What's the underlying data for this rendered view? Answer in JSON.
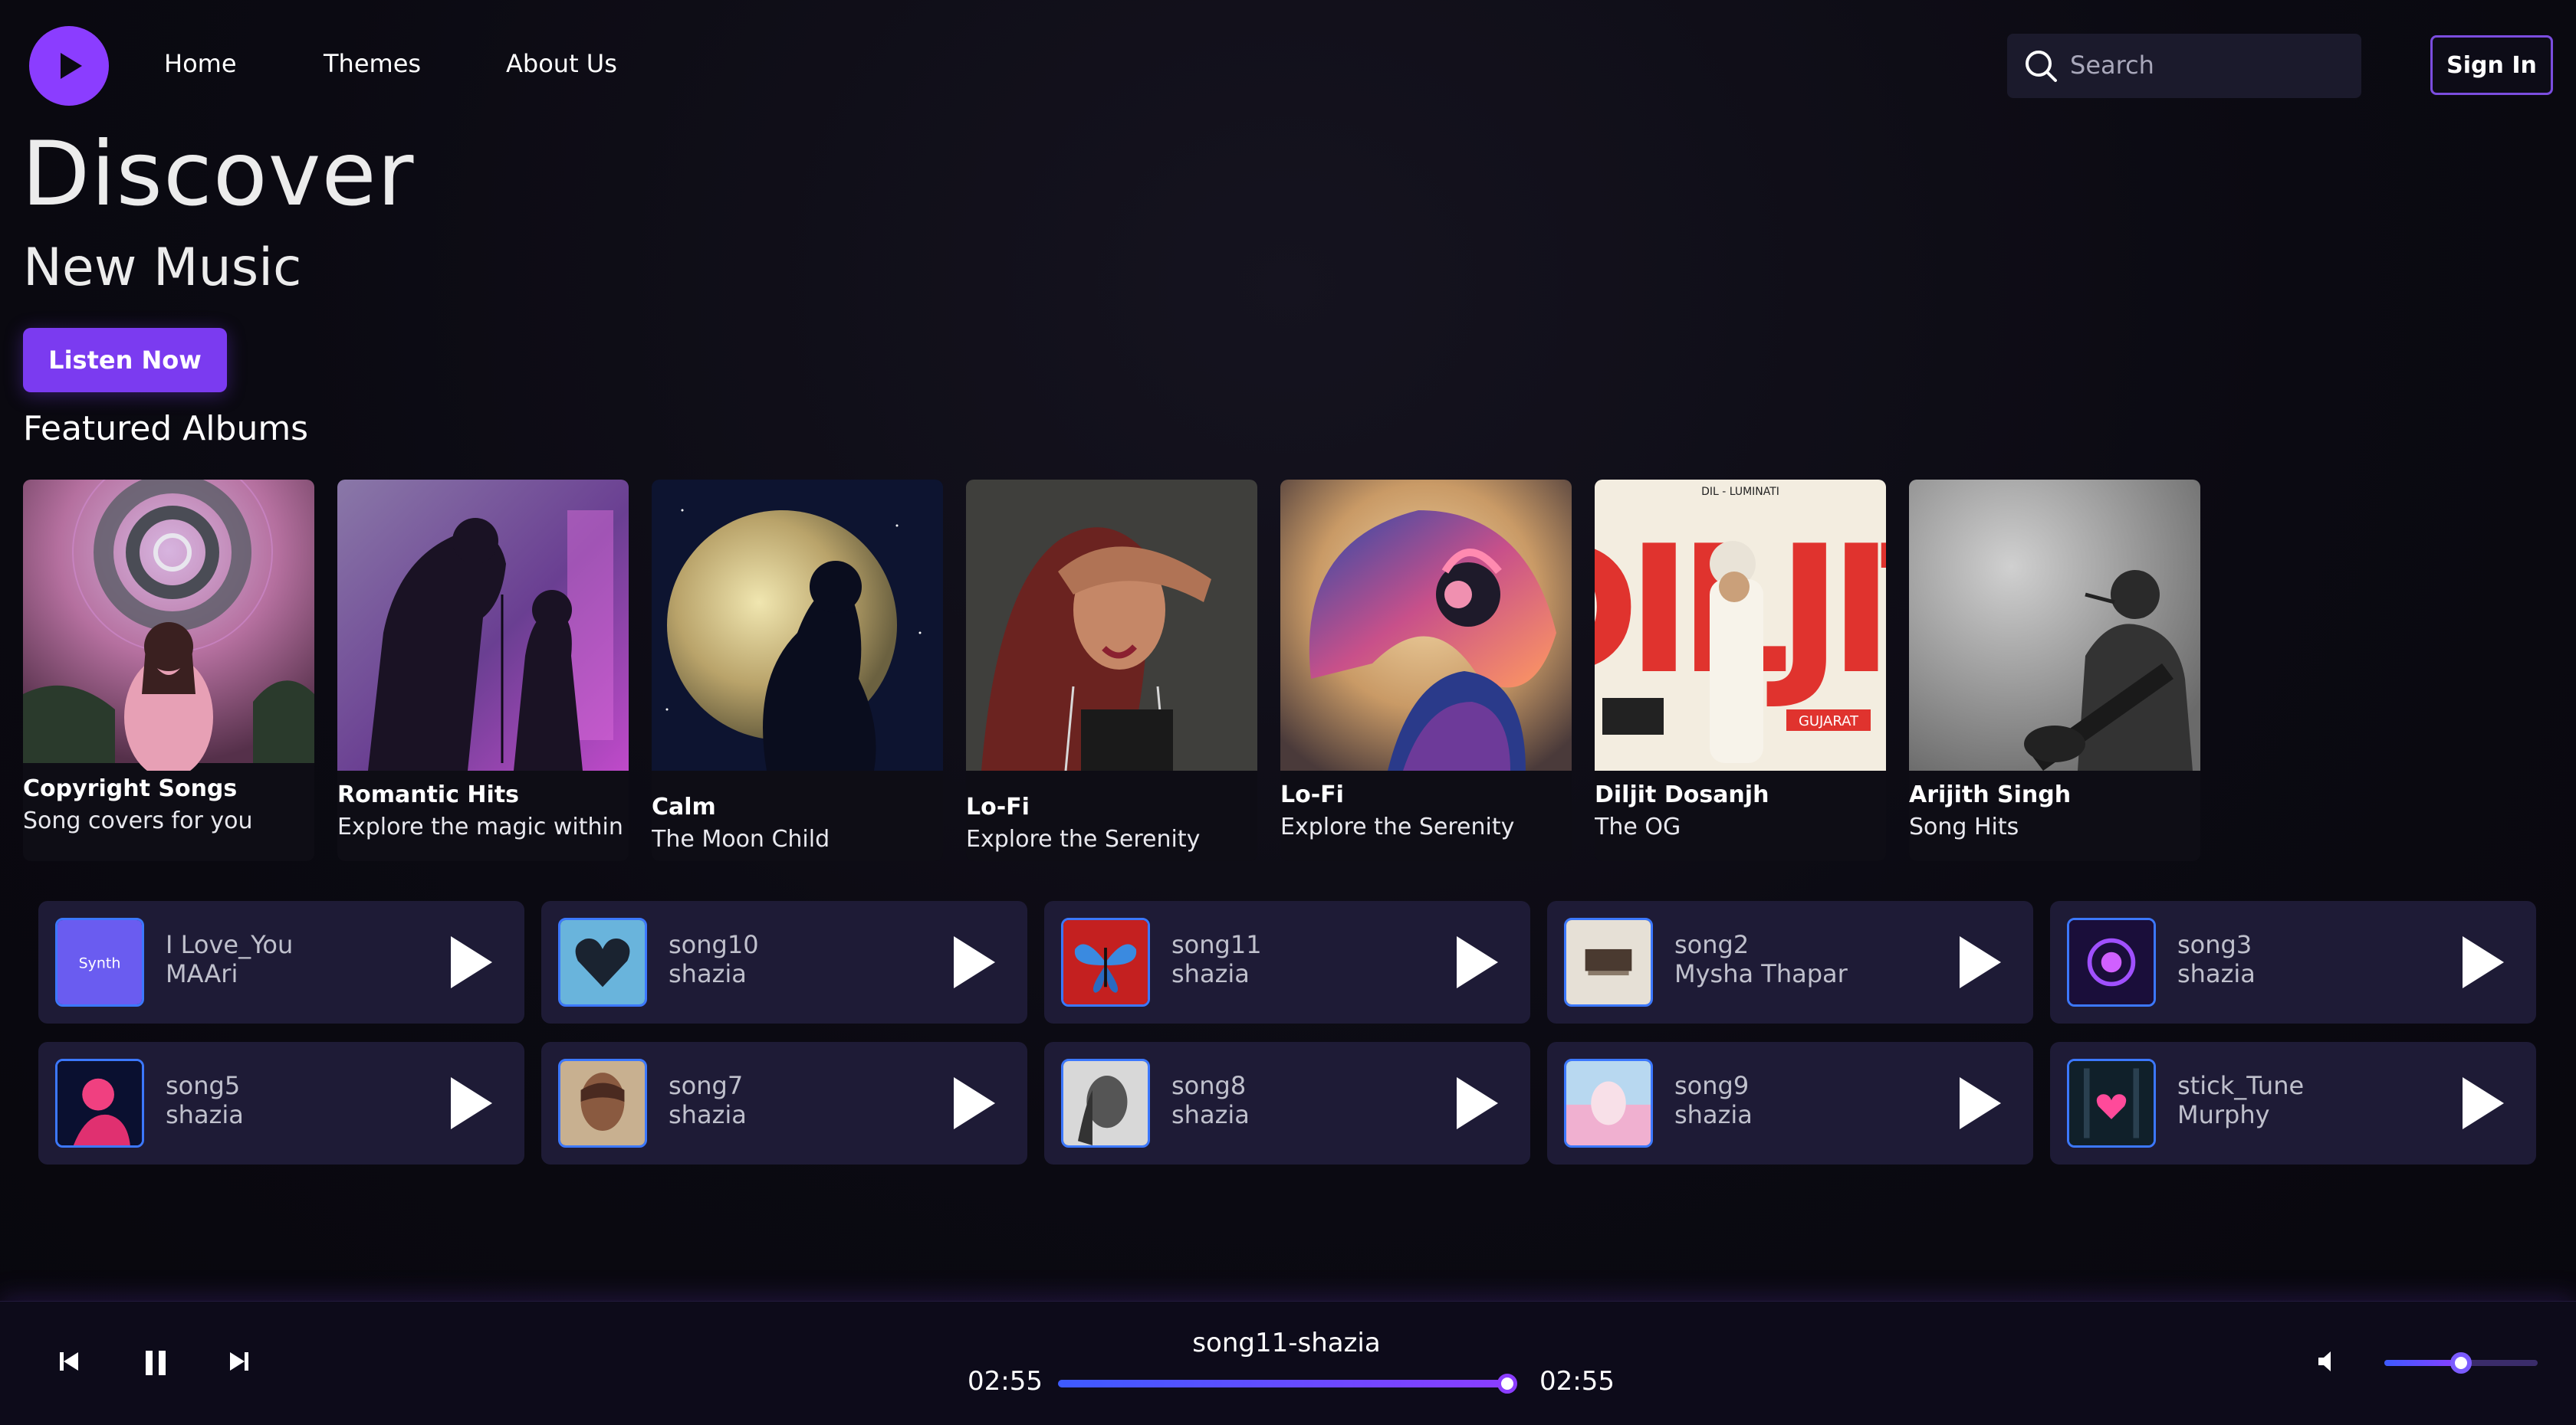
{
  "nav": {
    "links": [
      "Home",
      "Themes",
      "About Us"
    ],
    "search_placeholder": "Search",
    "sign_in": "Sign In",
    "logo_icon": "play-icon"
  },
  "hero": {
    "title": "Discover",
    "subtitle": "New Music",
    "cta": "Listen Now"
  },
  "featured": {
    "heading": "Featured Albums",
    "albums": [
      {
        "title": "Copyright Songs",
        "subtitle": "Song covers for you"
      },
      {
        "title": "Romantic Hits",
        "subtitle": "Explore the magic within"
      },
      {
        "title": "Calm",
        "subtitle": "The Moon Child"
      },
      {
        "title": "Lo-Fi",
        "subtitle": "Explore the Serenity"
      },
      {
        "title": "Lo-Fi",
        "subtitle": "Explore the Serenity"
      },
      {
        "title": "Diljit Dosanjh",
        "subtitle": "The OG",
        "cover_text": "DILJIT",
        "cover_top_text": "DIL - LUMINATI",
        "cover_badge": "GUJARAT"
      },
      {
        "title": "Arijith Singh",
        "subtitle": "Song Hits"
      }
    ]
  },
  "songs": [
    {
      "title": "I Love_You",
      "artist": "MAAri",
      "thumb_label": "Synth"
    },
    {
      "title": "song10",
      "artist": "shazia"
    },
    {
      "title": "song11",
      "artist": "shazia"
    },
    {
      "title": "song2",
      "artist": "Mysha Thapar"
    },
    {
      "title": "song3",
      "artist": "shazia"
    },
    {
      "title": "song5",
      "artist": "shazia"
    },
    {
      "title": "song7",
      "artist": "shazia"
    },
    {
      "title": "song8",
      "artist": "shazia"
    },
    {
      "title": "song9",
      "artist": "shazia"
    },
    {
      "title": "stick_Tune",
      "artist": "Murphy"
    }
  ],
  "player": {
    "now_playing": "song11-shazia",
    "current_time": "02:55",
    "total_time": "02:55",
    "progress": 1.0,
    "volume": 0.5,
    "accent": "#8b3dff"
  }
}
